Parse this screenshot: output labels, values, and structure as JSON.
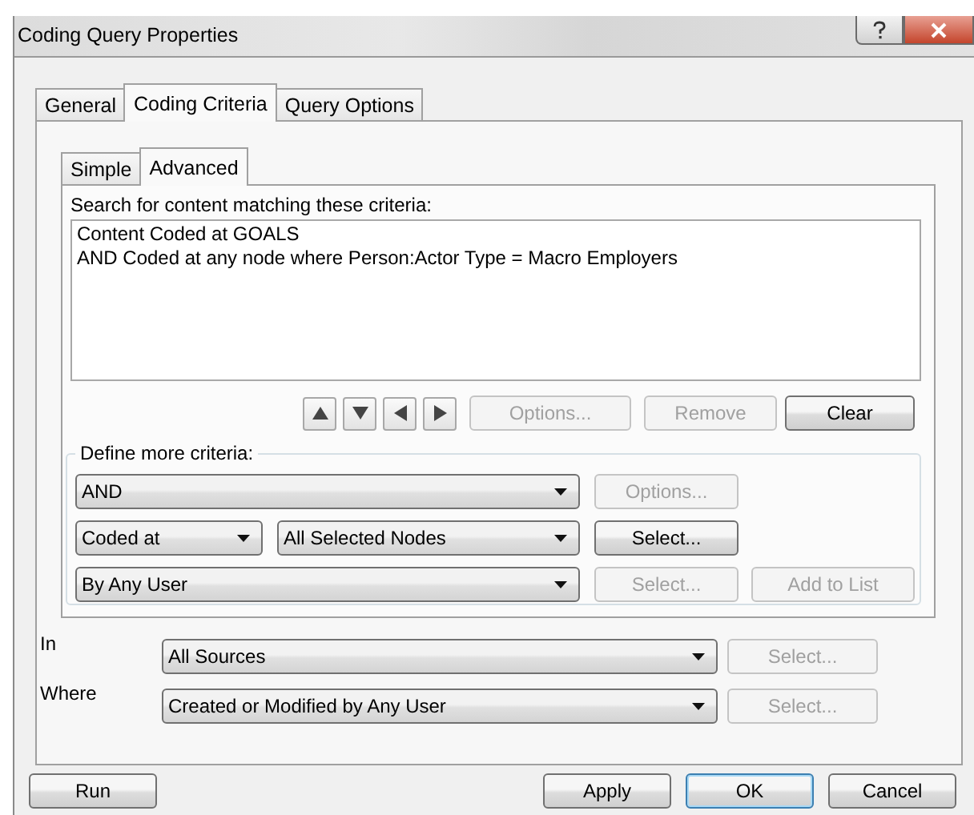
{
  "window": {
    "title": "Coding Query Properties"
  },
  "tabs": [
    {
      "label": "General",
      "selected": false
    },
    {
      "label": "Coding Criteria",
      "selected": true
    },
    {
      "label": "Query Options",
      "selected": false
    }
  ],
  "subtabs": [
    {
      "label": "Simple",
      "selected": false
    },
    {
      "label": "Advanced",
      "selected": true
    }
  ],
  "criteria": {
    "label": "Search for content matching these criteria:",
    "lines": [
      "Content Coded at GOALS",
      "AND Coded at any node where Person:Actor Type = Macro Employers"
    ]
  },
  "move_buttons": [
    {
      "kind": "up"
    },
    {
      "kind": "down"
    },
    {
      "kind": "left"
    },
    {
      "kind": "right"
    }
  ],
  "criteria_buttons": [
    {
      "label": "Options...",
      "disabled": true
    },
    {
      "label": "Remove",
      "disabled": true
    },
    {
      "label": "Clear",
      "disabled": false
    }
  ],
  "define": {
    "label": "Define more criteria:",
    "rows": [
      {
        "combos": [
          "AND"
        ],
        "buttons": [
          {
            "label": "Options...",
            "disabled": true
          }
        ]
      },
      {
        "combos": [
          "Coded at",
          "All Selected Nodes"
        ],
        "buttons": [
          {
            "label": "Select...",
            "disabled": false
          }
        ]
      },
      {
        "combos": [
          "By Any User"
        ],
        "buttons": [
          {
            "label": "Select...",
            "disabled": true
          },
          {
            "label": "Add to List",
            "disabled": true
          }
        ]
      }
    ]
  },
  "scope_rows": [
    {
      "label": "In",
      "value": "All Sources",
      "button": {
        "label": "Select...",
        "disabled": true
      }
    },
    {
      "label": "Where",
      "value": "Created or Modified by Any User",
      "button": {
        "label": "Select...",
        "disabled": true
      }
    }
  ],
  "footer_buttons": [
    {
      "label": "Run",
      "default": false
    },
    {
      "label": "Apply",
      "default": false
    },
    {
      "label": "OK",
      "default": true
    },
    {
      "label": "Cancel",
      "default": false
    }
  ]
}
